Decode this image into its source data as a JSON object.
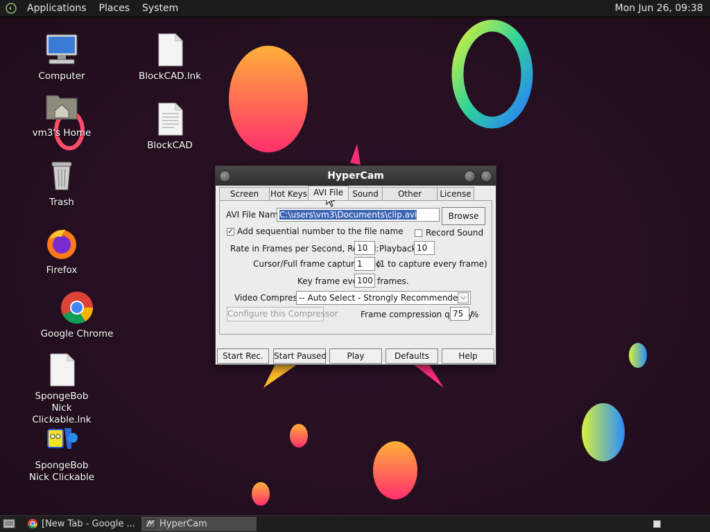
{
  "top_panel": {
    "menus": [
      "Applications",
      "Places",
      "System"
    ],
    "clock": "Mon Jun 26, 09:38"
  },
  "desktop_icons": [
    {
      "label": "Computer",
      "icon": "computer-icon"
    },
    {
      "label": "vm3's Home",
      "icon": "home-folder-icon"
    },
    {
      "label": "Trash",
      "icon": "trash-icon"
    },
    {
      "label": "Firefox",
      "icon": "firefox-icon"
    },
    {
      "label": "Google Chrome",
      "icon": "chrome-icon"
    },
    {
      "label": "SpongeBob Nick Clickable.lnk",
      "icon": "file-icon"
    },
    {
      "label": "SpongeBob Nick Clickable",
      "icon": "spongebob-icon"
    },
    {
      "label": "BlockCAD.lnk",
      "icon": "file-icon"
    },
    {
      "label": "BlockCAD",
      "icon": "text-file-icon"
    }
  ],
  "window": {
    "title": "HyperCam",
    "tabs": [
      "Screen Area",
      "Hot Keys",
      "AVI File",
      "Sound",
      "Other Options",
      "License"
    ],
    "active_tab": "AVI File",
    "avi_file_name_label": "AVI File Name:",
    "avi_file_name_value": "C:\\users\\vm3\\Documents\\clip.avi",
    "browse_label": "Browse",
    "add_sequential_label": "Add sequential number to the file name",
    "add_sequential_checked": true,
    "record_sound_label": "Record Sound",
    "record_sound_checked": false,
    "rate_label": "Rate in Frames per Second,  Record:",
    "record_rate": "10",
    "playback_label": "Playback:",
    "playback_rate": "10",
    "capture_ratio_label": "Cursor/Full frame capture ratio",
    "capture_ratio_value": "1",
    "capture_ratio_hint": "(1 to capture every frame)",
    "key_frame_label": "Key frame every",
    "key_frame_value": "100",
    "key_frame_unit": "frames.",
    "video_compressor_label": "Video Compressor:",
    "video_compressor_value": "-- Auto Select - Strongly Recommended!",
    "configure_compressor_label": "Configure this Compressor",
    "compression_quality_label": "Frame compression quality",
    "compression_quality_value": "75",
    "compression_quality_unit": "%",
    "buttons": [
      "Start Rec.",
      "Start Paused",
      "Play",
      "Defaults",
      "Help"
    ]
  },
  "taskbar": {
    "tasks": [
      {
        "label": "[New Tab - Google ...",
        "icon": "chrome-icon",
        "active": false
      },
      {
        "label": "HyperCam",
        "icon": "hypercam-icon",
        "active": true
      }
    ]
  },
  "colors": {
    "desktop_bg": "#24101f",
    "selection": "#3c64b4",
    "titlebar": "#2d2d2d"
  }
}
